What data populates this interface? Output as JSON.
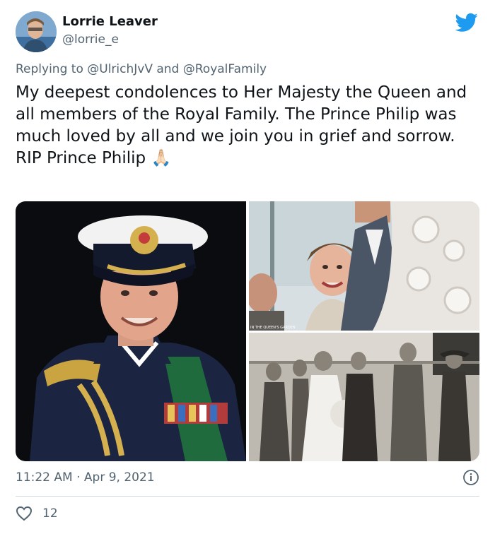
{
  "author": {
    "name": "Lorrie Leaver",
    "handle": "@lorrie_e",
    "avatar_icon": "avatar"
  },
  "brand": {
    "icon": "twitter-bird-icon",
    "color": "#1d9bf0"
  },
  "reply": {
    "prefix": "Replying to",
    "mention_1": "@UlrichJvV",
    "joiner": "and",
    "mention_2": "@RoyalFamily"
  },
  "tweet": {
    "line_1": "My deepest condolences to Her Majesty the Queen and all members of the Royal Family. The Prince Philip was much loved by all and we join you in grief and sorrow.",
    "line_2": "RIP Prince Philip",
    "emoji": "🙏🏻"
  },
  "media": {
    "photo_1_caption": "",
    "photo_2_watermark": "IN THE QUEEN'S GARDEN"
  },
  "meta": {
    "timestamp": "11:22 AM · Apr 9, 2021",
    "info_icon": "info-icon"
  },
  "engagement": {
    "like_icon": "heart-icon",
    "like_count": "12"
  }
}
